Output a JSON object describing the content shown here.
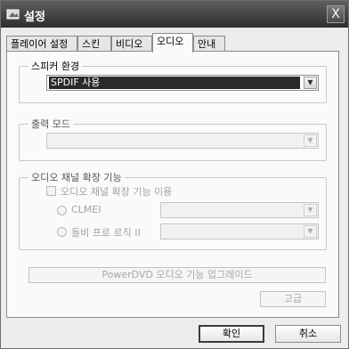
{
  "window": {
    "title": "설정",
    "close_symbol": "X"
  },
  "tabs": [
    {
      "label": "플레이어 설정",
      "active": false
    },
    {
      "label": "스킨",
      "active": false
    },
    {
      "label": "비디오",
      "active": false
    },
    {
      "label": "오디오",
      "active": true
    },
    {
      "label": "안내",
      "active": false
    }
  ],
  "speaker": {
    "legend": "스피커 환경",
    "selected": "SPDIF 사용"
  },
  "output": {
    "legend": "출력 모드",
    "selected": ""
  },
  "expansion": {
    "legend": "오디오 채널 확장 기능",
    "checkbox_label": "오디오 채널 확장 기능 이용",
    "radio1_label": "CLMEI",
    "radio2_label": "돌비 프로 로직 II"
  },
  "upgrade_button": "PowerDVD 오디오 기능 업그레이드",
  "advanced_button": "고급",
  "ok_button": "확인",
  "cancel_button": "취소",
  "colors": {
    "titlebar": "#3c3c3c",
    "selection": "#2a2a2a",
    "disabled_text": "#a2a2a2"
  }
}
